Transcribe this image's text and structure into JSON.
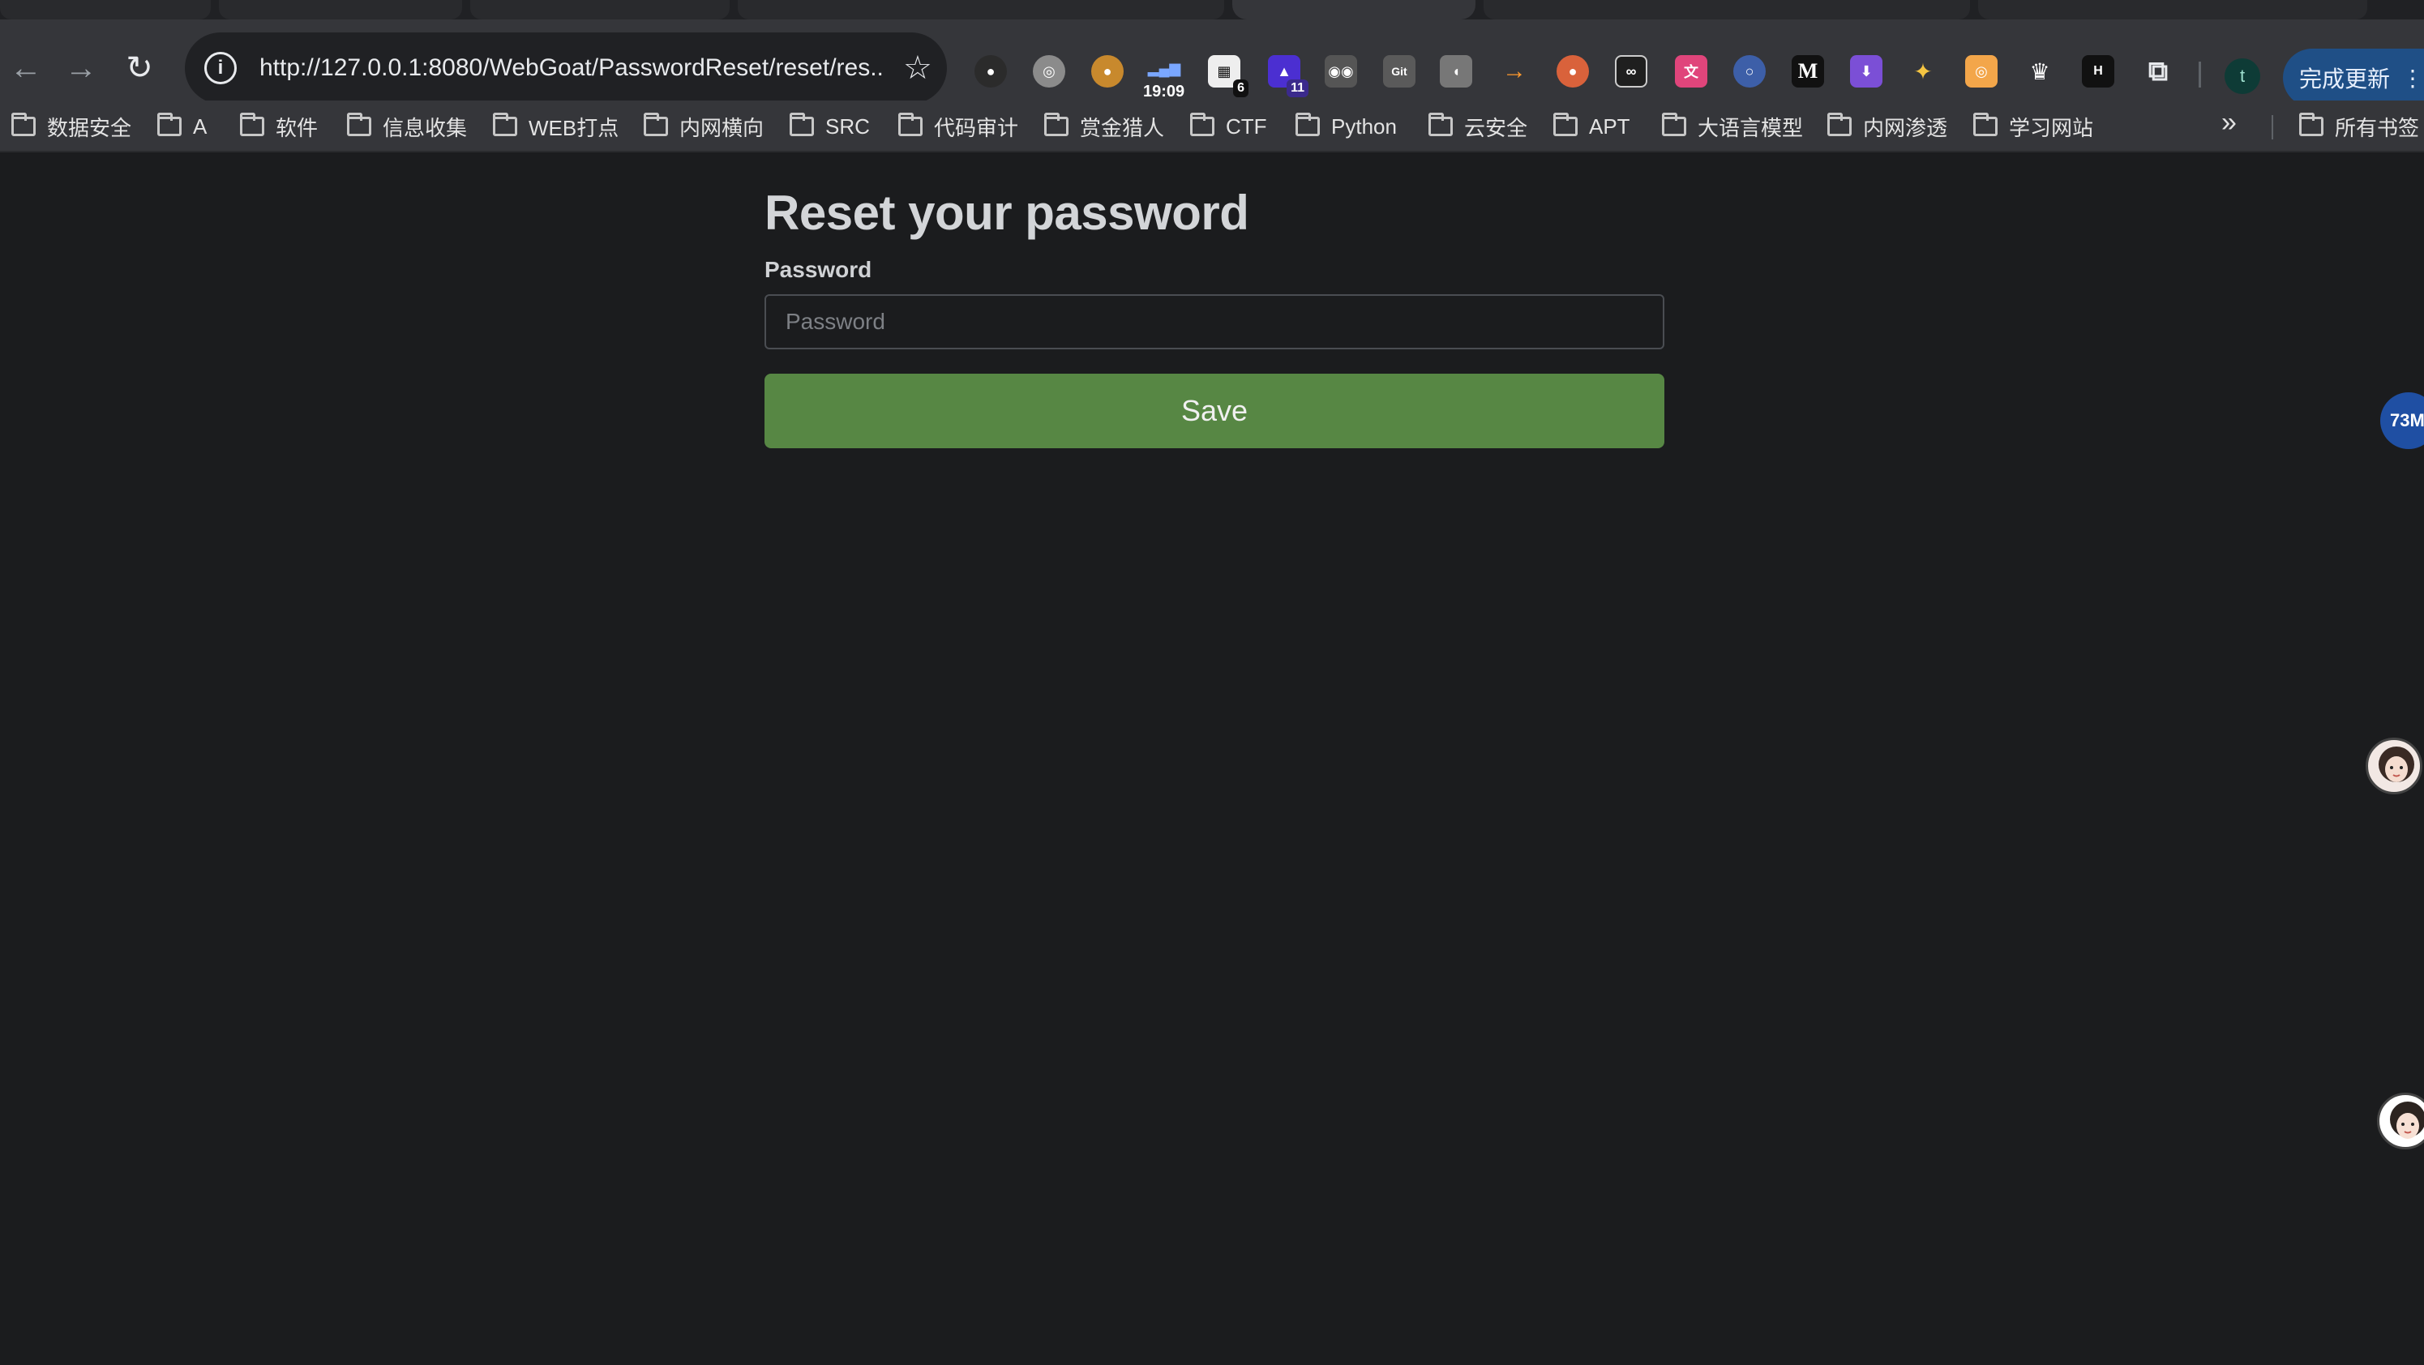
{
  "browser": {
    "url": "http://127.0.0.1:8080/WebGoat/PasswordReset/reset/res...",
    "extensions_time": "19:09",
    "extension_badge_6": "6",
    "extension_badge_11": "11",
    "profile_initial": "t",
    "update_label": "完成更新",
    "more_icon": "⋮"
  },
  "bookmarks": [
    {
      "label": "数据安全"
    },
    {
      "label": "A"
    },
    {
      "label": "软件"
    },
    {
      "label": "信息收集"
    },
    {
      "label": "WEB打点"
    },
    {
      "label": "内网横向"
    },
    {
      "label": "SRC"
    },
    {
      "label": "代码审计"
    },
    {
      "label": "赏金猎人"
    },
    {
      "label": "CTF"
    },
    {
      "label": "Python"
    },
    {
      "label": "云安全"
    },
    {
      "label": "APT"
    },
    {
      "label": "大语言模型"
    },
    {
      "label": "内网渗透"
    },
    {
      "label": "学习网站"
    }
  ],
  "all_bookmarks": "所有书签",
  "more_bookmarks_icon": "»",
  "form": {
    "title": "Reset your password",
    "password_label": "Password",
    "password_placeholder": "Password",
    "password_value": "",
    "save_label": "Save"
  },
  "floating_badge": "73M",
  "colors": {
    "page_bg": "#1b1c1e",
    "save_button": "#578744",
    "toolbar": "#35363a",
    "update_button": "#1f4f86"
  }
}
